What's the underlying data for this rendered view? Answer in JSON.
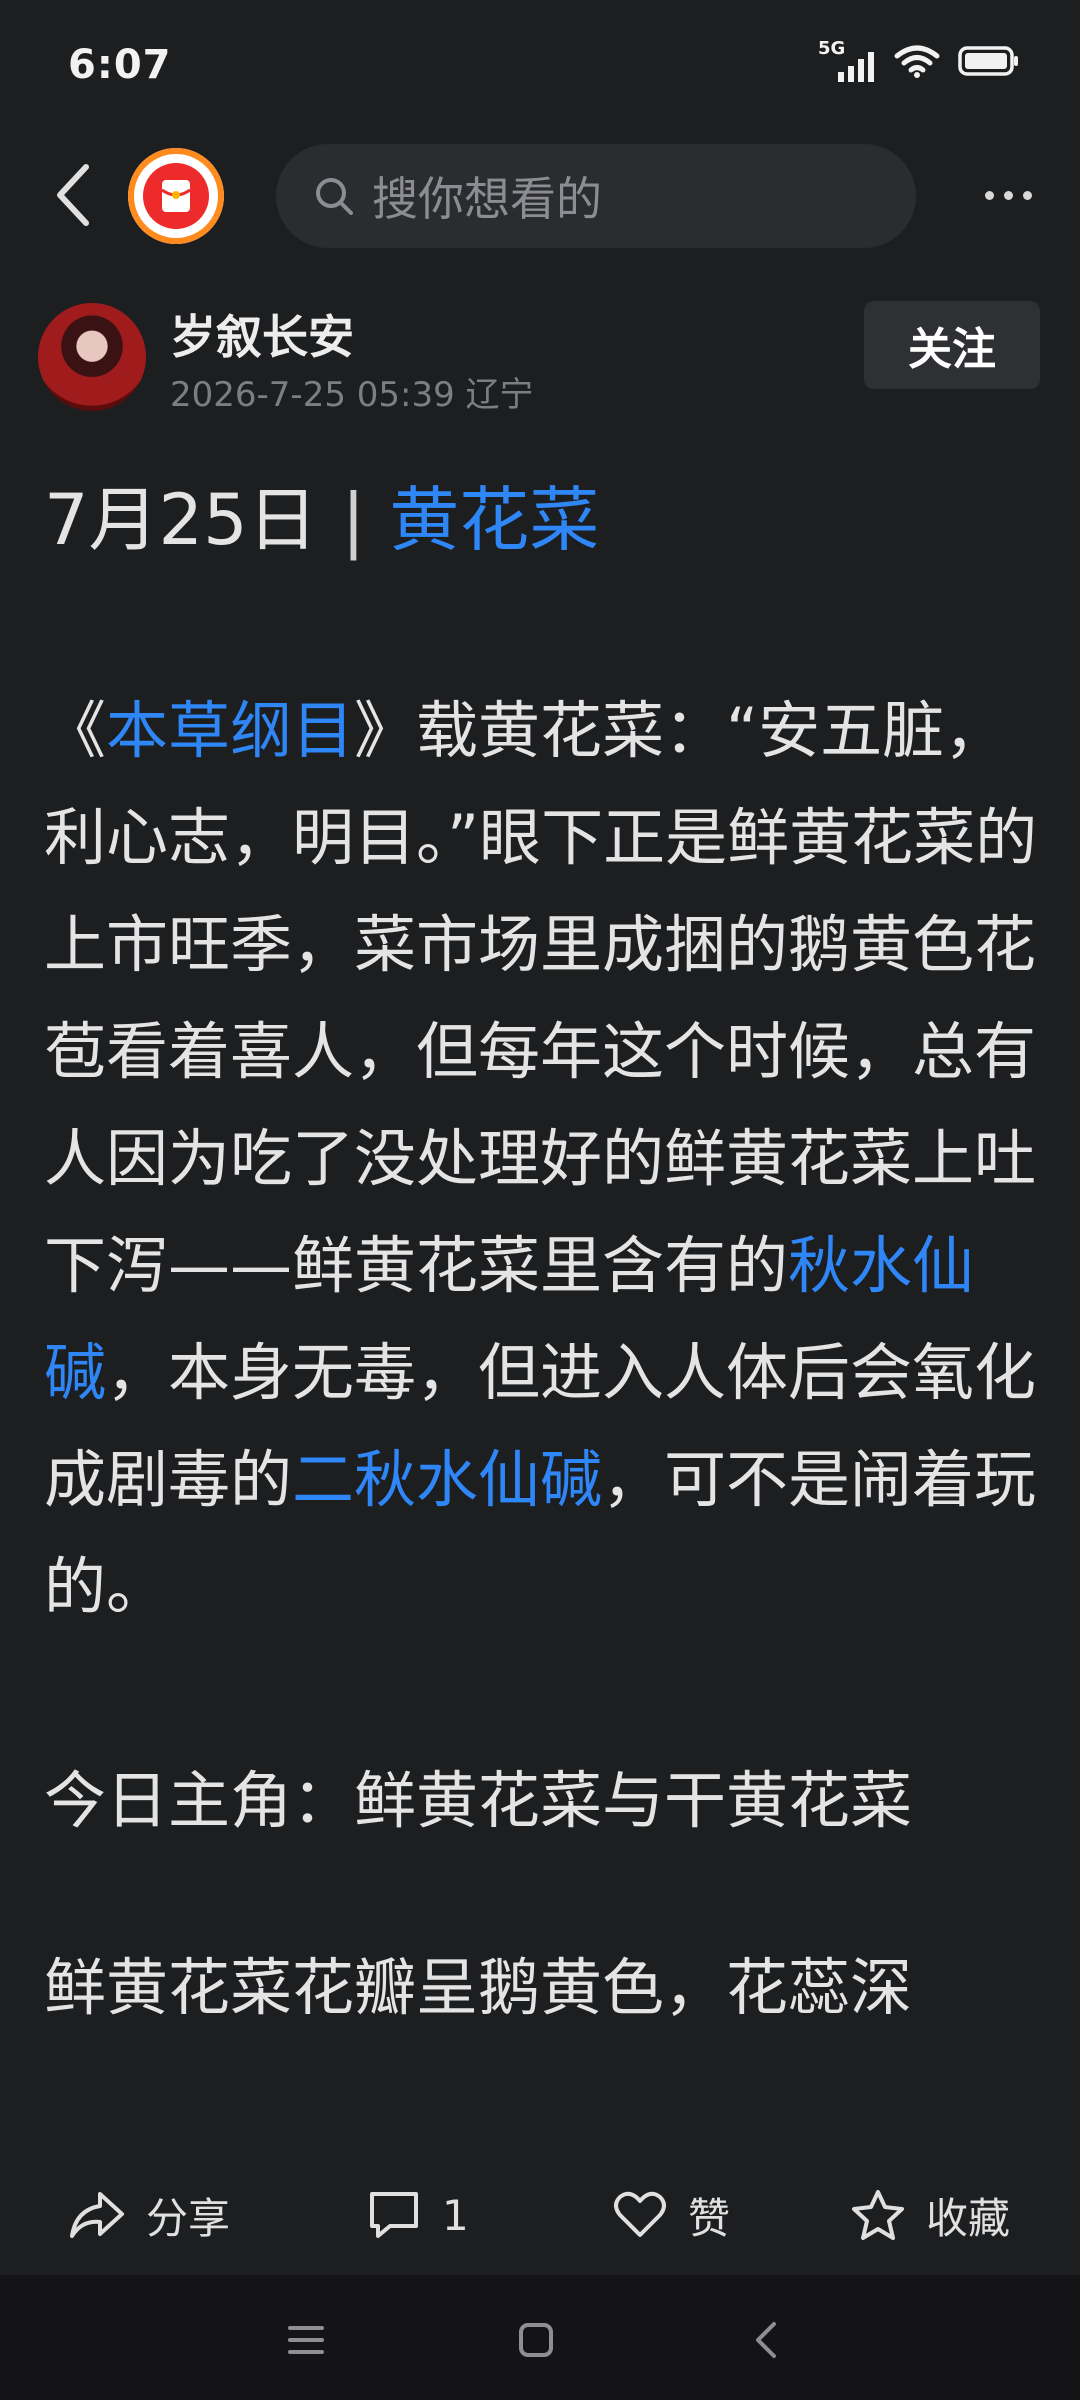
{
  "status_bar": {
    "time": "6:07",
    "network": "5G"
  },
  "search": {
    "placeholder": "搜你想看的"
  },
  "author": {
    "name": "岁叙长安",
    "meta": "2026-7-25 05:39 辽宁",
    "follow_label": "关注"
  },
  "article": {
    "title_date": "7月25日",
    "title_sep": "|",
    "title_topic": "黄花菜",
    "p1_open": "《",
    "p1_book": "本草纲目",
    "p1_close": "》",
    "p1_text_a": "载黄花菜：“安五脏，利心志，明目。”眼下正是鲜黄花菜的上市旺季，菜市场里成捆的鹅黄色花苞看着喜人，但每年这个时候，总有人因为吃了没处理好的鲜黄花菜上吐下泻——鲜黄花菜里含有的",
    "p1_term1": "秋水仙碱",
    "p1_text_b": "，本身无毒，但进入人体后会氧化成剧毒的",
    "p1_term2": "二秋水仙碱",
    "p1_text_c": "，可不是闹着玩的。",
    "p2": "今日主角：鲜黄花菜与干黄花菜",
    "p3_partial": "鲜黄花菜花瓣呈鹅黄色，花蕊深"
  },
  "actions": {
    "share_label": "分享",
    "comment_count": "1",
    "like_label": "赞",
    "collect_label": "收藏"
  }
}
